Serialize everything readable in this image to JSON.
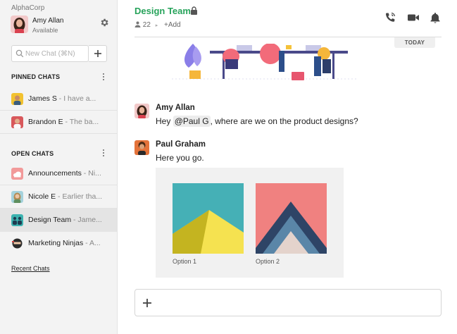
{
  "app": {
    "org_name": "AlphaCorp",
    "user": {
      "name": "Amy Allan",
      "status": "Available"
    }
  },
  "sidebar": {
    "search": {
      "value": "",
      "placeholder": "New Chat (⌘N)"
    },
    "pinned_title": "PINNED CHATS",
    "pinned": [
      {
        "name": "James S",
        "preview": " - I have a..."
      },
      {
        "name": "Brandon E",
        "preview": " - The ba..."
      }
    ],
    "open_title": "OPEN CHATS",
    "open": [
      {
        "name": "Announcements",
        "preview": " - Ni..."
      },
      {
        "name": "Nicole E",
        "preview": " - Earlier tha..."
      },
      {
        "name": "Design Team",
        "preview": " - Jame..."
      },
      {
        "name": "Marketing Ninjas",
        "preview": " - A..."
      }
    ],
    "recent_link": "Recent Chats"
  },
  "header": {
    "title": "Design Team",
    "member_count": "22",
    "add_label": "+Add"
  },
  "date_divider": "TODAY",
  "messages": [
    {
      "author": "Amy Allan",
      "text_before": "Hey ",
      "mention": "@Paul G",
      "text_after": ", where are we on the product designs?"
    },
    {
      "author": "Paul Graham",
      "text": "Here you go."
    }
  ],
  "attachment": {
    "options": [
      {
        "label": "Option 1"
      },
      {
        "label": "Option 2"
      }
    ]
  },
  "composer": {
    "value": "",
    "placeholder": ""
  },
  "colors": {
    "accent_green": "#27a35b",
    "sidebar_bg": "#f3f3f3",
    "active_item_bg": "#e4e4e4",
    "option1_bg": "#45b0b6",
    "option1_mountain": "#f5e250",
    "option2_bg": "#f08180",
    "option2_dark": "#2e4466",
    "option2_mid": "#5a86a8",
    "option2_light": "#e4d3cc"
  },
  "icons": {
    "gear": "gear-icon",
    "search": "search-icon",
    "plus": "plus-icon",
    "lock": "lock-icon",
    "person": "person-icon",
    "phone": "phone-icon",
    "video": "video-icon",
    "bell": "bell-icon",
    "more": "more-vertical-icon"
  }
}
